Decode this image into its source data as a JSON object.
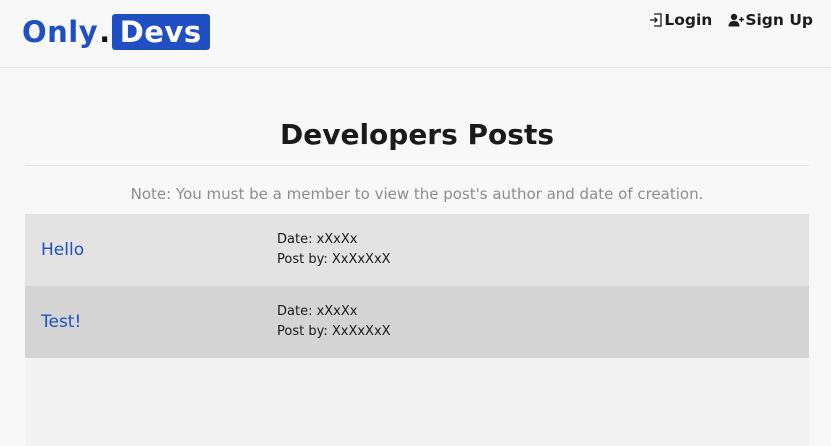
{
  "brand": {
    "part1": "Only",
    "dot": ".",
    "part2": "Devs",
    "color": "#1f4fc2"
  },
  "nav": {
    "login": {
      "label": "Login",
      "icon": "login-icon"
    },
    "signup": {
      "label": "Sign Up",
      "icon": "user-plus-icon"
    }
  },
  "main": {
    "title": "Developers Posts",
    "note": "Note: You must be a member to view the post's author and date of creation.",
    "posts": [
      {
        "title": "Hello",
        "date": "Date: xXxXx",
        "author": "Post by: XxXxXxX"
      },
      {
        "title": "Test!",
        "date": "Date: xXxXx",
        "author": "Post by: XxXxXxX"
      }
    ]
  }
}
